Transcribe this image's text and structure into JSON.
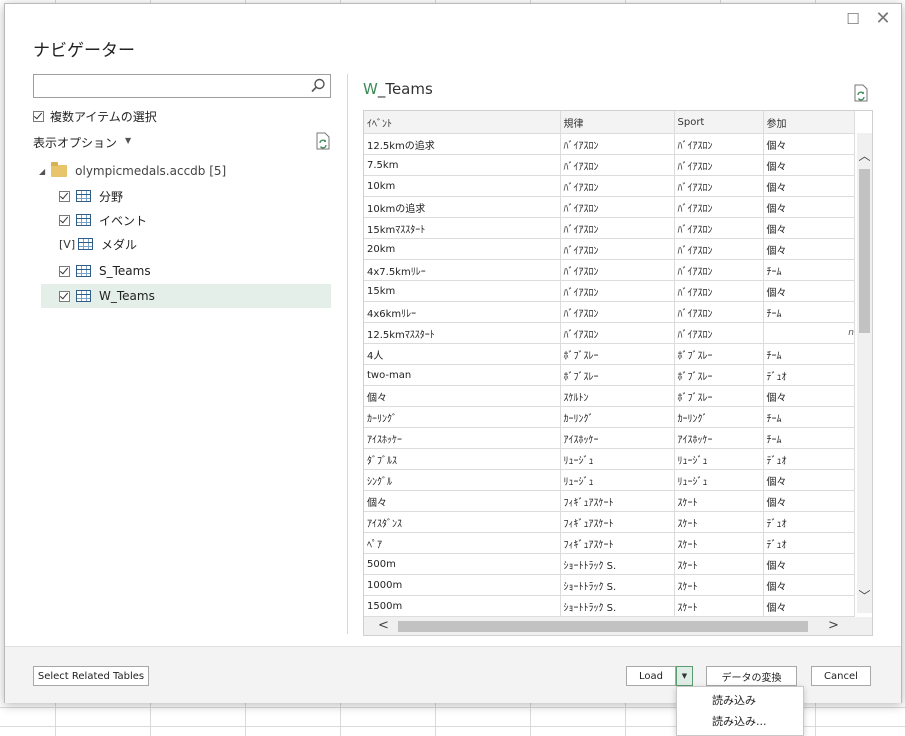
{
  "dialog": {
    "title": "ナビゲーター",
    "search": {
      "value": "",
      "placeholder": ""
    },
    "multi_select_label": "複数アイテムの選択",
    "display_options_label": "表示オプション",
    "tree": {
      "root_label": "olympicmedals.accdb [5]",
      "items": [
        {
          "label": "分野",
          "checked": true
        },
        {
          "label": "イベント",
          "checked": true
        },
        {
          "label": "メダル",
          "checked": false,
          "partial_marker": "[V]"
        },
        {
          "label": "S_Teams",
          "checked": true
        },
        {
          "label": "W_Teams",
          "checked": true,
          "selected": true
        }
      ]
    },
    "preview": {
      "title_prefix": "W",
      "title_rest": "_Teams",
      "columns": [
        "ｲﾍﾞﾝﾄ",
        "規律",
        "Sport",
        "参加"
      ],
      "rows": [
        [
          "12.5kmの追求",
          "ﾊﾞｲｱｽﾛﾝ",
          "ﾊﾞｲｱｽﾛﾝ",
          "個々"
        ],
        [
          "7.5km",
          "ﾊﾞｲｱｽﾛﾝ",
          "ﾊﾞｲｱｽﾛﾝ",
          "個々"
        ],
        [
          "10km",
          "ﾊﾞｲｱｽﾛﾝ",
          "ﾊﾞｲｱｽﾛﾝ",
          "個々"
        ],
        [
          "10kmの追求",
          "ﾊﾞｲｱｽﾛﾝ",
          "ﾊﾞｲｱｽﾛﾝ",
          "個々"
        ],
        [
          "15kmﾏｽｽﾀｰﾄ",
          "ﾊﾞｲｱｽﾛﾝ",
          "ﾊﾞｲｱｽﾛﾝ",
          "個々"
        ],
        [
          "20km",
          "ﾊﾞｲｱｽﾛﾝ",
          "ﾊﾞｲｱｽﾛﾝ",
          "個々"
        ],
        [
          "4x7.5kmﾘﾚｰ",
          "ﾊﾞｲｱｽﾛﾝ",
          "ﾊﾞｲｱｽﾛﾝ",
          "ﾁｰﾑ"
        ],
        [
          "15km",
          "ﾊﾞｲｱｽﾛﾝ",
          "ﾊﾞｲｱｽﾛﾝ",
          "個々"
        ],
        [
          "4x6kmﾘﾚｰ",
          "ﾊﾞｲｱｽﾛﾝ",
          "ﾊﾞｲｱｽﾛﾝ",
          "ﾁｰﾑ"
        ],
        [
          "12.5kmﾏｽｽﾀｰﾄ",
          "ﾊﾞｲｱｽﾛﾝ",
          "ﾊﾞｲｱｽﾛﾝ",
          ""
        ],
        [
          "4人",
          "ﾎﾞﾌﾞｽﾚｰ",
          "ﾎﾞﾌﾞｽﾚｰ",
          "ﾁｰﾑ"
        ],
        [
          "two-man",
          "ﾎﾞﾌﾞｽﾚｰ",
          "ﾎﾞﾌﾞｽﾚｰ",
          "ﾃﾞｭｵ"
        ],
        [
          "個々",
          "ｽｹﾙﾄﾝ",
          "ﾎﾞﾌﾞｽﾚｰ",
          "個々"
        ],
        [
          "ｶｰﾘﾝｸﾞ",
          "ｶｰﾘﾝｸﾞ",
          "ｶｰﾘﾝｸﾞ",
          "ﾁｰﾑ"
        ],
        [
          "ｱｲｽﾎｯｹｰ",
          "ｱｲｽﾎｯｹｰ",
          "ｱｲｽﾎｯｹｰ",
          "ﾁｰﾑ"
        ],
        [
          "ﾀﾞﾌﾞﾙｽ",
          "ﾘｭｰｼﾞｭ",
          "ﾘｭｰｼﾞｭ",
          "ﾃﾞｭｵ"
        ],
        [
          "ｼﾝｸﾞﾙ",
          "ﾘｭｰｼﾞｭ",
          "ﾘｭｰｼﾞｭ",
          "個々"
        ],
        [
          "個々",
          "ﾌｨｷﾞｭｱｽｹｰﾄ",
          "ｽｹｰﾄ",
          "個々"
        ],
        [
          "ｱｲｽﾀﾞﾝｽ",
          "ﾌｨｷﾞｭｱｽｹｰﾄ",
          "ｽｹｰﾄ",
          "ﾃﾞｭｵ"
        ],
        [
          "ﾍﾟｱ",
          "ﾌｨｷﾞｭｱｽｹｰﾄ",
          "ｽｹｰﾄ",
          "ﾃﾞｭｵ"
        ],
        [
          "500m",
          "ｼｮｰﾄﾄﾗｯｸ S.",
          "ｽｹｰﾄ",
          "個々"
        ],
        [
          "1000m",
          "ｼｮｰﾄﾄﾗｯｸ S.",
          "ｽｹｰﾄ",
          "個々"
        ],
        [
          "1500m",
          "ｼｮｰﾄﾄﾗｯｸ S.",
          "ｽｹｰﾄ",
          "個々"
        ]
      ],
      "overflow_marker": "n"
    },
    "buttons": {
      "select_related": "Select Related Tables",
      "load": "Load",
      "transform": "データの変換",
      "cancel": "Cancel"
    },
    "load_menu": [
      "読み込み",
      "読み込み..."
    ]
  },
  "colors": {
    "accent": "#3b8a56",
    "selected_bg": "#e5efe9"
  }
}
